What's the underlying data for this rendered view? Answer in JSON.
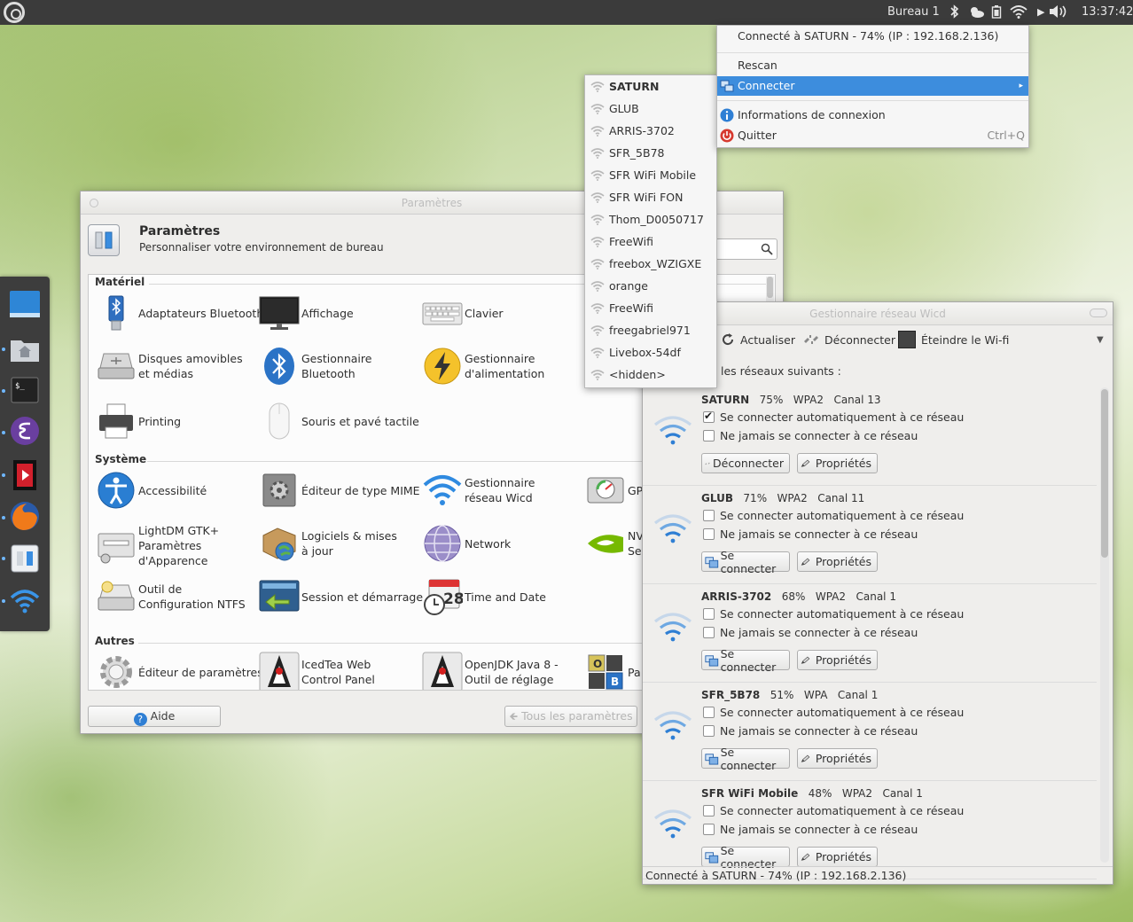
{
  "top_panel": {
    "workspace": "Bureau 1",
    "clock": "13:37:42",
    "tray_icons": [
      "bluetooth-icon",
      "weather-icon",
      "battery-icon",
      "wifi-icon",
      "volume-icon"
    ]
  },
  "tray_menu": {
    "status": "Connecté à SATURN - 74% (IP : 192.168.2.136)",
    "rescan": "Rescan",
    "connect": "Connecter",
    "connection_info": "Informations de connexion",
    "quit": "Quitter",
    "quit_accel": "Ctrl+Q"
  },
  "ssid_menu": {
    "items": [
      "SATURN",
      "GLUB",
      "ARRIS-3702",
      "SFR_5B78",
      "SFR WiFi Mobile",
      "SFR WiFi FON",
      "Thom_D0050717",
      "FreeWifi",
      "freebox_WZIGXE",
      "orange",
      "FreeWifi",
      "freegabriel971",
      "Livebox-54df",
      "<hidden>"
    ]
  },
  "settings": {
    "window_title": "Paramètres",
    "title": "Paramètres",
    "subtitle": "Personnaliser votre environnement de bureau",
    "sections": {
      "hardware": "Matériel",
      "system": "Système",
      "other": "Autres"
    },
    "items": {
      "bluetooth_adapters": "Adaptateurs Bluetooth",
      "display": "Affichage",
      "keyboard": "Clavier",
      "removable": "Disques amovibles et médias",
      "bt_manager": "Gestionnaire Bluetooth",
      "power": "Gestionnaire d'alimentation",
      "printing": "Printing",
      "mouse": "Souris et pavé tactile",
      "accessibility": "Accessibilité",
      "mime": "Éditeur de type MIME",
      "wicd": "Gestionnaire réseau Wicd",
      "gp_partial": "GP",
      "lightdm": "LightDM GTK+ Paramètres d'Apparence",
      "software": "Logiciels & mises à jour",
      "network": "Network",
      "nvidia_partial_1": "NV",
      "nvidia_partial_2": "Set",
      "ntfs": "Outil de Configuration NTFS",
      "session": "Session et démarrage",
      "time_date": "Time and Date",
      "calendar_day": "28",
      "settings_editor": "Éditeur de paramètres",
      "icedtea": "IcedTea Web Control Panel",
      "openjdk": "OpenJDK Java 8 - Outil de réglage",
      "par_partial": "Pa",
      "grid_o": "O",
      "grid_b": "B"
    },
    "help_button": "Aide",
    "all_settings_button": "Tous les paramètres"
  },
  "wicd": {
    "window_title": "Gestionnaire réseau Wicd",
    "toolbar": {
      "refresh": "Actualiser",
      "disconnect": "Déconnecter",
      "wifi_off": "Éteindre le Wi-fi"
    },
    "intro": "les réseaux suivants :",
    "auto_connect_label": "Se connecter automatiquement à ce réseau",
    "never_connect_label": "Ne jamais se connecter à ce réseau",
    "disconnect_button": "Déconnecter",
    "connect_button": "Se connecter",
    "properties_button": "Propriétés",
    "networks": [
      {
        "name": "SATURN",
        "signal": "75%",
        "security": "WPA2",
        "channel": "Canal 13",
        "auto": true,
        "connected": true
      },
      {
        "name": "GLUB",
        "signal": "71%",
        "security": "WPA2",
        "channel": "Canal 11",
        "auto": false,
        "connected": false
      },
      {
        "name": "ARRIS-3702",
        "signal": "68%",
        "security": "WPA2",
        "channel": "Canal 1",
        "auto": false,
        "connected": false
      },
      {
        "name": "SFR_5B78",
        "signal": "51%",
        "security": "WPA",
        "channel": "Canal 1",
        "auto": false,
        "connected": false
      },
      {
        "name": "SFR WiFi Mobile",
        "signal": "48%",
        "security": "WPA2",
        "channel": "Canal 1",
        "auto": false,
        "connected": false
      }
    ],
    "status": "Connecté à SATURN - 74% (IP : 192.168.2.136)"
  },
  "colors": {
    "accent": "#3d8ddd",
    "panel": "#3b3b3b",
    "wifi_blue": "#2f7fd4"
  }
}
